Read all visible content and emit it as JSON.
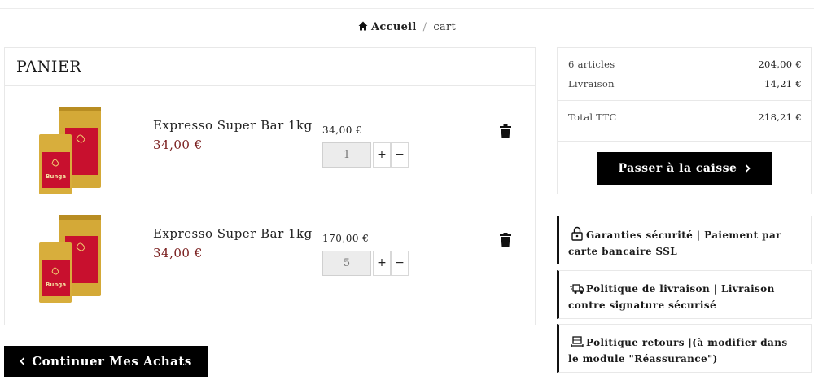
{
  "breadcrumb": {
    "home_label": "Accueil",
    "separator": "/",
    "current": "cart"
  },
  "cart": {
    "title": "PANIER",
    "items": [
      {
        "name": "Expresso Super Bar 1kg",
        "unit_price": "34,00 €",
        "line_total": "34,00 €",
        "quantity": "1",
        "image_brand": "Bunga"
      },
      {
        "name": "Expresso Super Bar 1kg",
        "unit_price": "34,00 €",
        "line_total": "170,00 €",
        "quantity": "5",
        "image_brand": "Bunga"
      }
    ],
    "plus_label": "+",
    "minus_label": "−",
    "continue_label": "Continuer Mes Achats"
  },
  "summary": {
    "articles_label": "6 articles",
    "articles_value": "204,00 €",
    "shipping_label": "Livraison",
    "shipping_value": "14,21 €",
    "total_label": "Total TTC",
    "total_value": "218,21 €",
    "checkout_label": "Passer à la caisse"
  },
  "reassurance": [
    {
      "icon": "lock-icon",
      "text": "Garanties sécurité | Paiement par carte bancaire SSL"
    },
    {
      "icon": "truck-icon",
      "text": "Politique de livraison | Livraison contre signature sécurisé"
    },
    {
      "icon": "return-icon",
      "text": "Politique retours |(à modifier dans le module \"Réassurance\")"
    }
  ],
  "colors": {
    "price": "#7a1f1f",
    "button_bg": "#000000",
    "package_gold": "#d4a937",
    "package_red": "#c8102e"
  }
}
